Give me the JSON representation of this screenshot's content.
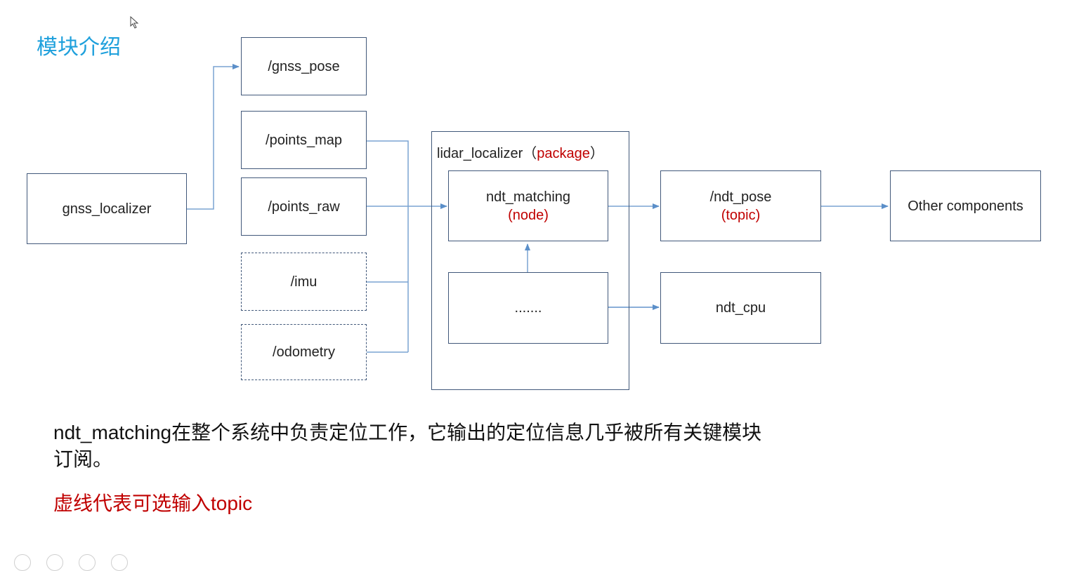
{
  "title": "模块介绍",
  "nodes": {
    "gnss_localizer": "gnss_localizer",
    "gnss_pose": "/gnss_pose",
    "points_map": "/points_map",
    "points_raw": "/points_raw",
    "imu": "/imu",
    "odometry": "/odometry",
    "ndt_matching": "ndt_matching",
    "ndt_matching_sub": "(node)",
    "ellipsis": ".......",
    "ndt_pose": "/ndt_pose",
    "ndt_pose_sub": "(topic)",
    "ndt_cpu": "ndt_cpu",
    "other": "Other components"
  },
  "package": {
    "name": "lidar_localizer",
    "open": "（",
    "type": "package",
    "close": "）"
  },
  "description": "ndt_matching在整个系统中负责定位工作，它输出的定位信息几乎被所有关键模块订阅。",
  "note": "虚线代表可选输入topic",
  "colors": {
    "title": "#1ea0dc",
    "accent_red": "#c00000",
    "box_border": "#41587a",
    "arrow": "#5b8fc9"
  }
}
